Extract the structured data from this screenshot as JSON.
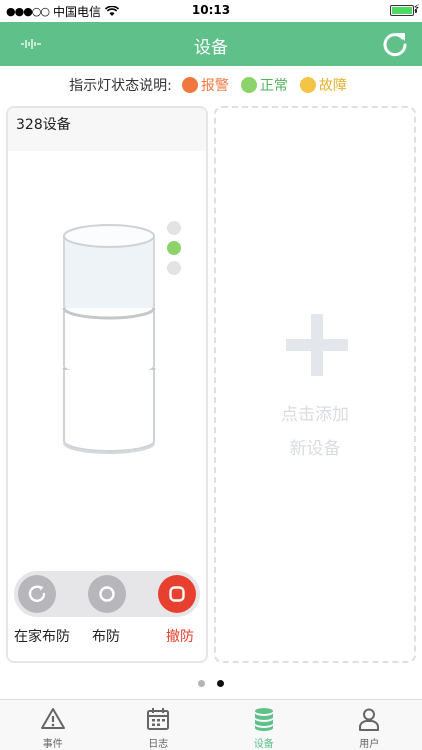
{
  "status_bar": {
    "carrier": "中国电信",
    "time": "10:13"
  },
  "nav": {
    "title": "设备"
  },
  "legend": {
    "label": "指示灯状态说明:",
    "items": [
      {
        "text": "报警",
        "color": "#f2773f"
      },
      {
        "text": "正常",
        "color": "#8dd26a"
      },
      {
        "text": "故障",
        "color": "#f6c445"
      }
    ]
  },
  "device_card": {
    "name": "328设备",
    "indicator_active": "正常",
    "controls": [
      {
        "label": "在家布防",
        "state": "inactive"
      },
      {
        "label": "布防",
        "state": "inactive"
      },
      {
        "label": "撤防",
        "state": "active"
      }
    ]
  },
  "add_card": {
    "line1": "点击添加",
    "line2": "新设备"
  },
  "pagination": {
    "total": 2,
    "current": 2
  },
  "tabs": [
    {
      "label": "事件",
      "icon": "warning-icon",
      "active": false
    },
    {
      "label": "日志",
      "icon": "calendar-icon",
      "active": false
    },
    {
      "label": "设备",
      "icon": "database-icon",
      "active": true
    },
    {
      "label": "用户",
      "icon": "user-icon",
      "active": false
    }
  ]
}
